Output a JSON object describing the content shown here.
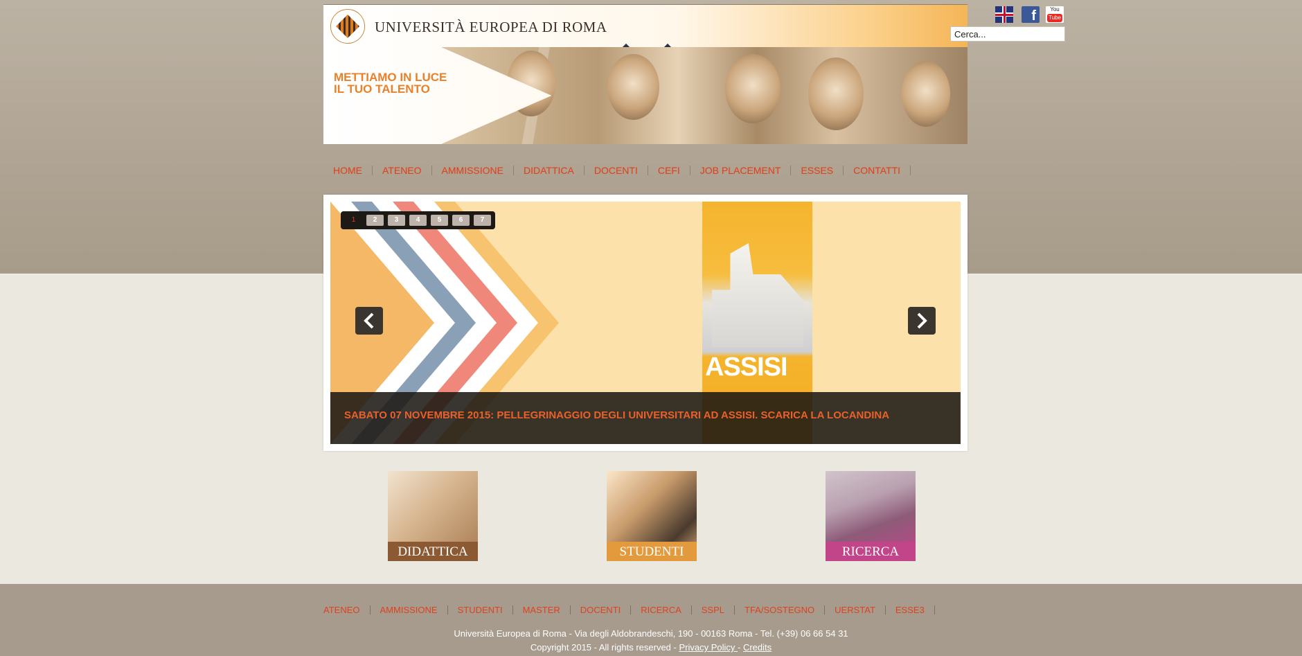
{
  "header": {
    "logo_text": "UNIVERSITÀ EUROPEA DI ROMA",
    "tagline_line1": "METTIAMO IN LUCE",
    "tagline_line2": "IL TUO TALENTO"
  },
  "search": {
    "placeholder": "Cerca..."
  },
  "social": {
    "language_icon": "uk-flag-icon",
    "facebook_icon": "facebook-icon",
    "facebook_glyph": "f",
    "youtube_icon": "youtube-icon",
    "youtube_top": "You",
    "youtube_bottom": "Tube"
  },
  "main_nav": [
    "HOME",
    "ATENEO",
    "AMMISSIONE",
    "DIDATTICA",
    "DOCENTI",
    "CEFI",
    "JOB PLACEMENT",
    "ESSES",
    "CONTATTI"
  ],
  "slider": {
    "pages": [
      "1",
      "2",
      "3",
      "4",
      "5",
      "6",
      "7"
    ],
    "active_page": "1",
    "poster_title": "ASSISI",
    "caption": "SABATO 07 NOVEMBRE 2015: PELLEGRINAGGIO DEGLI UNIVERSITARI AD ASSISI. SCARICA LA LOCANDINA"
  },
  "quick_links": [
    {
      "label": "DIDATTICA",
      "color": "#8b5a33"
    },
    {
      "label": "STUDENTI",
      "color": "#e39a3c"
    },
    {
      "label": "RICERCA",
      "color": "#c2458a"
    }
  ],
  "footer_nav": [
    "ATENEO",
    "AMMISSIONE",
    "STUDENTI",
    "MASTER",
    "DOCENTI",
    "RICERCA",
    "SSPL",
    "TFA/SOSTEGNO",
    "UERSTAT",
    "ESSE3"
  ],
  "footer": {
    "address": "Università Europea di Roma - Via degli Aldobrandeschi, 190 - 00163 Roma - Tel. (+39) 06 66 54 31",
    "copyright": "Copyright 2015 - All rights reserved - ",
    "privacy": "Privacy Policy ",
    "separator": " - ",
    "credits": "Credits"
  },
  "colors": {
    "accent": "#e0411d",
    "caption": "#e8612b",
    "brand_orange": "#e8812a"
  }
}
